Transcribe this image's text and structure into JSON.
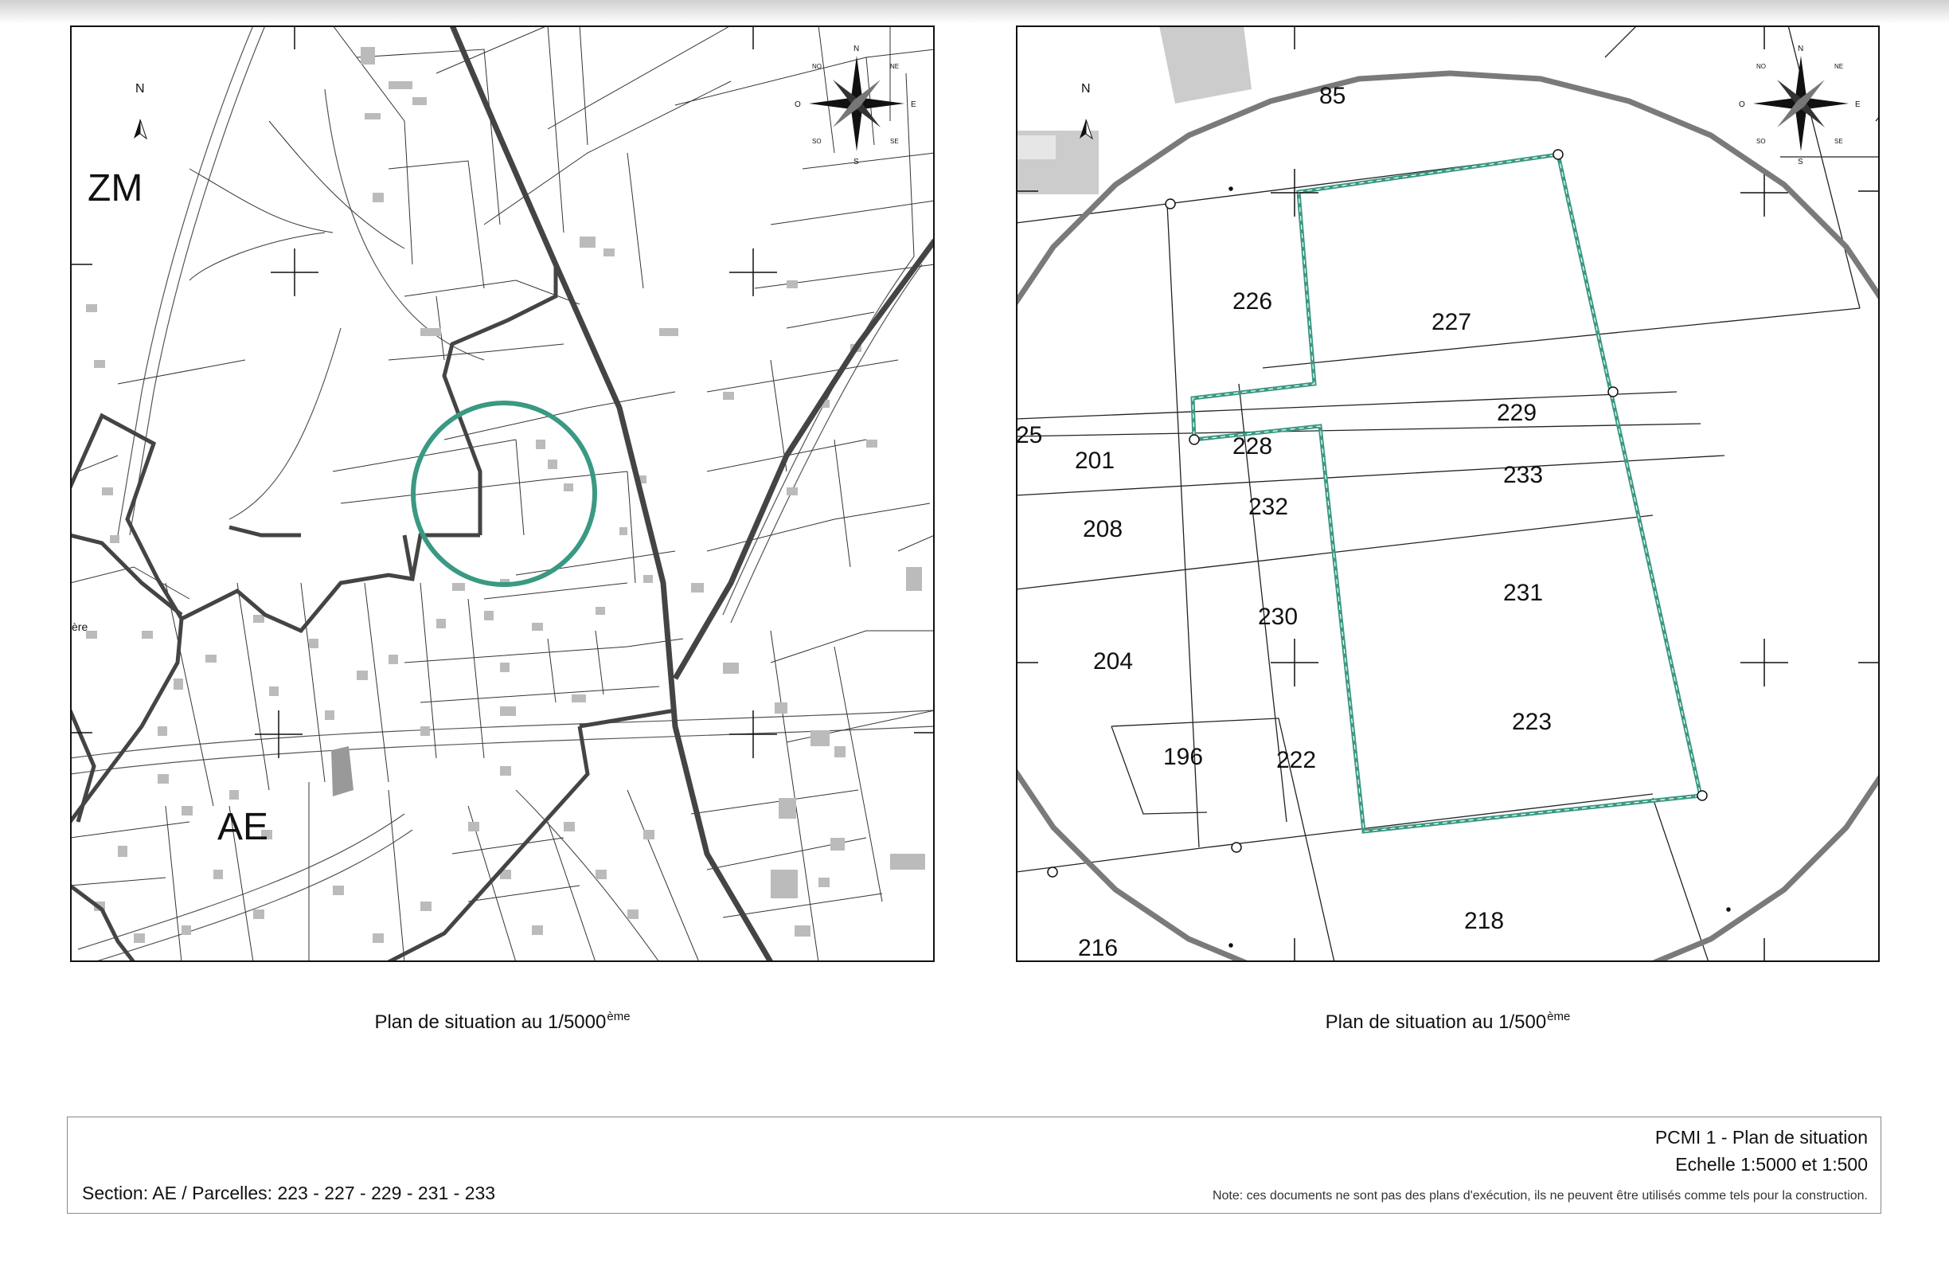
{
  "left_map": {
    "caption": "Plan de situation au 1/5000",
    "caption_sup": "ème",
    "zones": [
      "ZM",
      "AE"
    ],
    "fragment_label": "ère",
    "north_label": "N",
    "compass": {
      "n": "N",
      "s": "S",
      "e": "E",
      "o": "O",
      "ne": "NE",
      "no": "NO",
      "se": "SE",
      "so": "SO"
    },
    "circle_color": "#3a9982"
  },
  "right_map": {
    "caption": "Plan de situation au 1/500",
    "caption_sup": "ème",
    "north_label": "N",
    "compass": {
      "n": "N",
      "s": "S",
      "e": "E",
      "o": "O",
      "ne": "NE",
      "no": "NO",
      "se": "SE",
      "so": "SO"
    },
    "parcels": {
      "p85": "85",
      "p226": "226",
      "p227": "227",
      "p229": "229",
      "p25": "25",
      "p201": "201",
      "p228": "228",
      "p233": "233",
      "p208": "208",
      "p232": "232",
      "p231": "231",
      "p230": "230",
      "p204": "204",
      "p223": "223",
      "p196": "196",
      "p222": "222",
      "p218": "218",
      "p216": "216"
    },
    "outline_color": "#3a9982"
  },
  "cartouche": {
    "title": "PCMI 1 - Plan de situation",
    "scale": "Echelle 1:5000 et 1:500",
    "note": "Note: ces documents ne sont pas des plans d'exécution, ils ne peuvent être utilisés comme tels pour la construction.",
    "section": "Section: AE / Parcelles: 223 - 227 - 229 - 231 - 233"
  }
}
